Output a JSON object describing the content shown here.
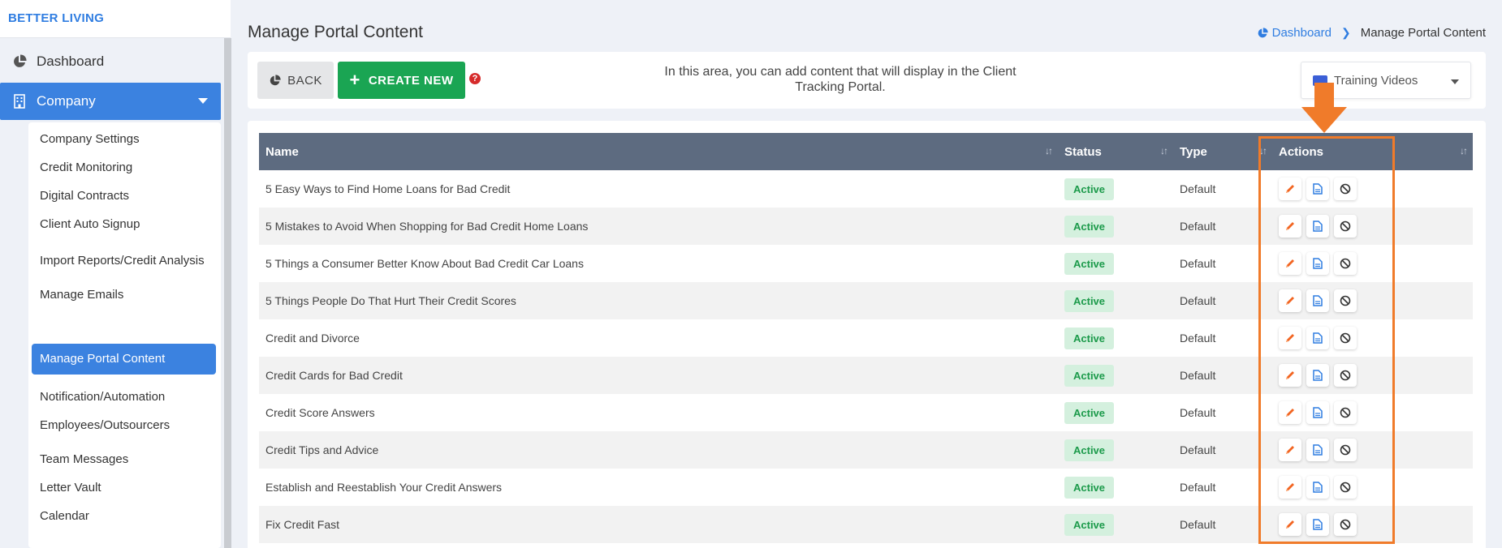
{
  "brand": "BETTER LIVING",
  "nav": {
    "dashboard": "Dashboard",
    "company": "Company",
    "submenu": [
      "Company Settings",
      "Credit Monitoring",
      "Digital Contracts",
      "Client Auto Signup",
      "Import Reports/Credit Analysis",
      "Manage Emails",
      "Manage Portal Content",
      "Notification/Automation",
      "Employees/Outsourcers",
      "Team Messages",
      "Letter Vault",
      "Calendar"
    ],
    "active_submenu": "Manage Portal Content"
  },
  "page": {
    "title": "Manage Portal Content",
    "breadcrumb": {
      "home": "Dashboard",
      "current": "Manage Portal Content"
    }
  },
  "toolbar": {
    "back_label": "BACK",
    "create_label": "CREATE NEW",
    "help_glyph": "?",
    "info_text": "In this area, you can add content that will display in the Client Tracking Portal.",
    "select_value": "Training Videos"
  },
  "table": {
    "headers": {
      "name": "Name",
      "status": "Status",
      "type": "Type",
      "actions": "Actions"
    },
    "rows": [
      {
        "name": "5 Easy Ways to Find Home Loans for Bad Credit",
        "status": "Active",
        "type": "Default"
      },
      {
        "name": "5 Mistakes to Avoid When Shopping for Bad Credit Home Loans",
        "status": "Active",
        "type": "Default"
      },
      {
        "name": "5 Things a Consumer Better Know About Bad Credit Car Loans",
        "status": "Active",
        "type": "Default"
      },
      {
        "name": "5 Things People Do That Hurt Their Credit Scores",
        "status": "Active",
        "type": "Default"
      },
      {
        "name": "Credit and Divorce",
        "status": "Active",
        "type": "Default"
      },
      {
        "name": "Credit Cards for Bad Credit",
        "status": "Active",
        "type": "Default"
      },
      {
        "name": "Credit Score Answers",
        "status": "Active",
        "type": "Default"
      },
      {
        "name": "Credit Tips and Advice",
        "status": "Active",
        "type": "Default"
      },
      {
        "name": "Establish and Reestablish Your Credit Answers",
        "status": "Active",
        "type": "Default"
      },
      {
        "name": "Fix Credit Fast",
        "status": "Active",
        "type": "Default"
      }
    ],
    "action_icons": [
      "pencil-icon",
      "document-icon",
      "ban-icon"
    ]
  },
  "colors": {
    "primary": "#3b82e0",
    "success": "#1aa553",
    "header_bg": "#5d6b80",
    "highlight": "#f07b2a",
    "edit_icon": "#f26522",
    "doc_icon": "#2f7de1"
  }
}
